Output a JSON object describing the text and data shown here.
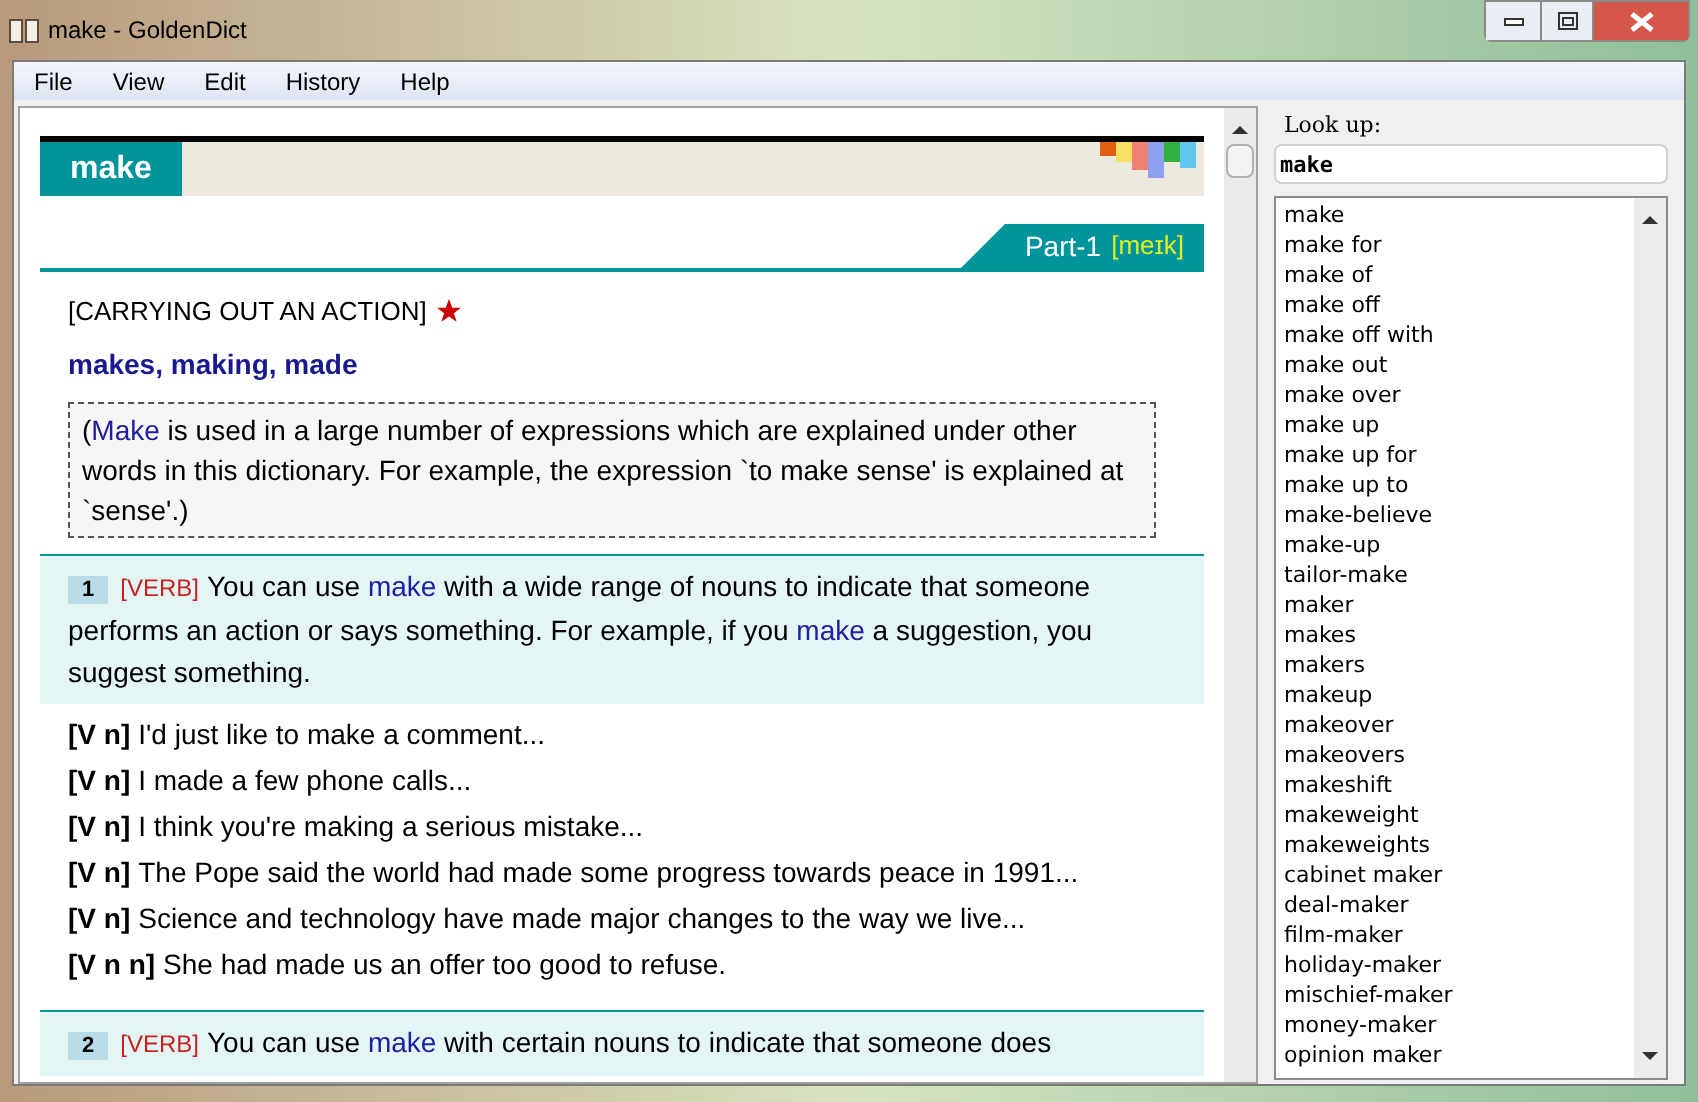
{
  "window": {
    "title": "make - GoldenDict"
  },
  "menu": [
    "File",
    "View",
    "Edit",
    "History",
    "Help"
  ],
  "article": {
    "headword": "make",
    "part_label": "Part-1",
    "pronunciation": "[meɪk]",
    "category": "[CARRYING OUT AN ACTION]",
    "forms": "makes, making, made",
    "note": [
      {
        "kind": "plain",
        "text": "("
      },
      {
        "kind": "keyword",
        "text": "Make"
      },
      {
        "kind": "plain",
        "text": " is used in a large number of expressions which are explained under other words in this dictionary. For example, the expression `to make sense' is explained at `sense'.)"
      }
    ],
    "senses": [
      {
        "number": "1",
        "pos": "[VERB]",
        "definition": [
          {
            "kind": "plain",
            "text": "You can use "
          },
          {
            "kind": "keyword",
            "text": "make"
          },
          {
            "kind": "plain",
            "text": " with a wide range of nouns to indicate that someone performs an action or says something. For example, if you "
          },
          {
            "kind": "keyword",
            "text": "make"
          },
          {
            "kind": "plain",
            "text": " a suggestion, you suggest something."
          }
        ],
        "examples": [
          {
            "pattern": "[V n]",
            "text": "I'd just like to make a comment..."
          },
          {
            "pattern": "[V n]",
            "text": "I made a few phone calls..."
          },
          {
            "pattern": "[V n]",
            "text": "I think you're making a serious mistake..."
          },
          {
            "pattern": "[V n]",
            "text": "The Pope said the world had made some progress towards peace in 1991..."
          },
          {
            "pattern": "[V n]",
            "text": "Science and technology have made major changes to the way we live..."
          },
          {
            "pattern": "[V n n]",
            "text": "She had made us an offer too good to refuse."
          }
        ]
      },
      {
        "number": "2",
        "pos": "[VERB]",
        "definition": [
          {
            "kind": "plain",
            "text": "You can use "
          },
          {
            "kind": "keyword",
            "text": "make"
          },
          {
            "kind": "plain",
            "text": " with certain nouns to indicate that someone does"
          }
        ]
      }
    ]
  },
  "lookup": {
    "label": "Look up:",
    "value": "make",
    "results": [
      "make",
      "make for",
      "make of",
      "make off",
      "make off with",
      "make out",
      "make over",
      "make up",
      "make up for",
      "make up to",
      "make-believe",
      "make-up",
      "tailor-make",
      "maker",
      "makes",
      "makers",
      "makeup",
      "makeover",
      "makeovers",
      "makeshift",
      "makeweight",
      "makeweights",
      "cabinet maker",
      "deal-maker",
      "film-maker",
      "holiday-maker",
      "mischief-maker",
      "money-maker",
      "opinion maker"
    ]
  }
}
